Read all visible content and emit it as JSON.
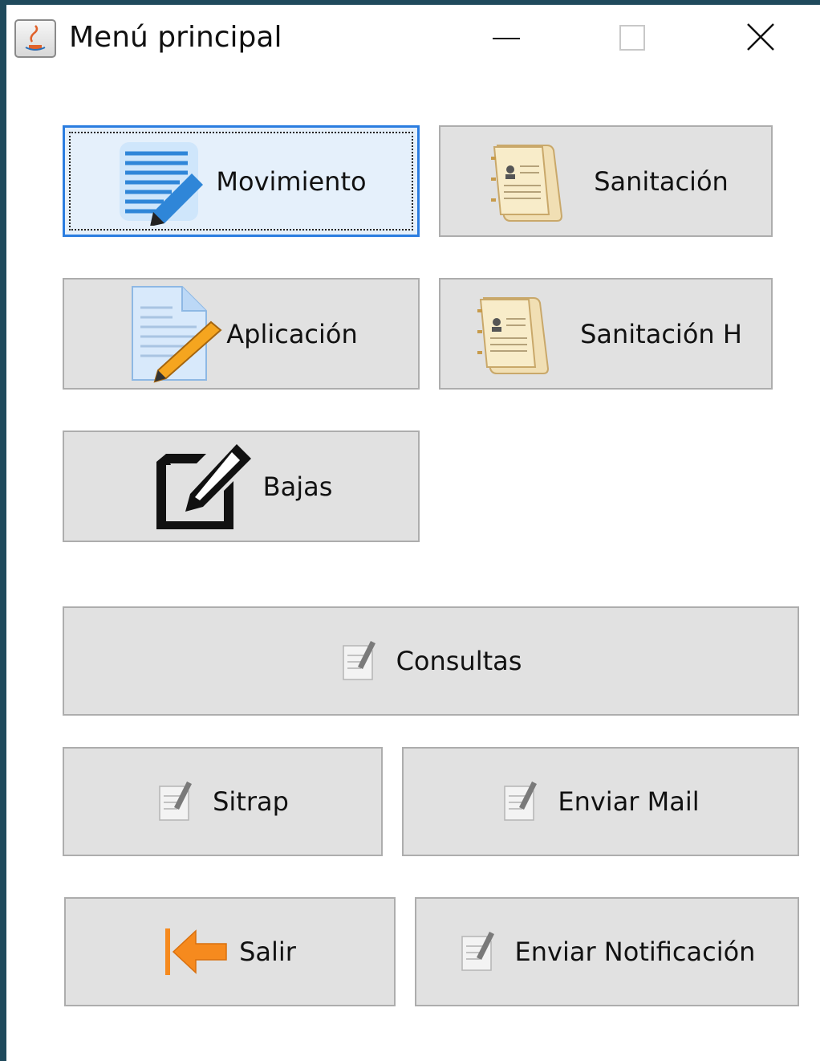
{
  "window": {
    "title": "Menú principal"
  },
  "buttons": {
    "movimiento": "Movimiento",
    "sanitacion": "Sanitación",
    "aplicacion": "Aplicación",
    "sanitacion_h": "Sanitación H",
    "bajas": "Bajas",
    "consultas": "Consultas",
    "sitrap": "Sitrap",
    "enviar_mail": "Enviar Mail",
    "salir": "Salir",
    "enviar_notificacion": "Enviar Notificación"
  },
  "icons": {
    "app": "java-app-icon",
    "movimiento": "edit-list-pencil-icon",
    "sanitacion": "contact-directory-icon",
    "aplicacion": "document-pencil-icon",
    "sanitacion_h": "contact-directory-icon",
    "bajas": "edit-square-icon",
    "consultas": "note-pencil-icon",
    "sitrap": "note-pencil-icon",
    "enviar_mail": "note-pencil-icon",
    "salir": "arrow-left-exit-icon",
    "enviar_notificacion": "note-pencil-icon"
  },
  "colors": {
    "button_face": "#e1e1e1",
    "focus_border": "#2b7de0",
    "exit_arrow": "#f68a1e"
  }
}
